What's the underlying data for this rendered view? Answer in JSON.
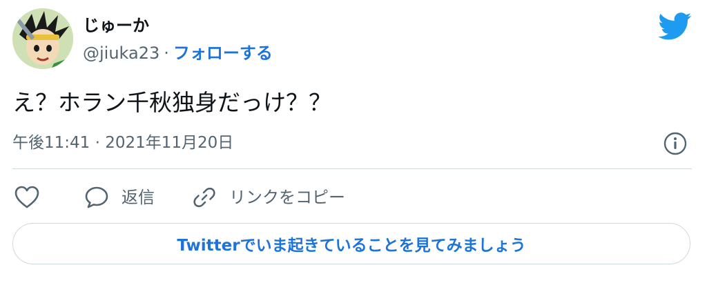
{
  "author": {
    "display_name": "じゅーか",
    "handle": "@jiuka23",
    "separator": "·",
    "follow_label": "フォローする",
    "avatar_icon": "user-avatar-icon"
  },
  "brand": {
    "icon": "twitter-bird-icon",
    "color": "#1d9bf0"
  },
  "tweet": {
    "text": "え？ホラン千秋独身だっけ？？",
    "timestamp": "午後11:41 · 2021年11月20日",
    "info_icon": "info-icon"
  },
  "actions": {
    "like_icon": "heart-icon",
    "reply_icon": "speech-bubble-icon",
    "reply_label": "返信",
    "copy_icon": "link-icon",
    "copy_label": "リンクをコピー"
  },
  "cta": {
    "label": "Twitterでいま起きていることを見てみましょう"
  },
  "colors": {
    "accent": "#1d73d8",
    "secondary_text": "#536471",
    "border": "#cfd9de"
  }
}
